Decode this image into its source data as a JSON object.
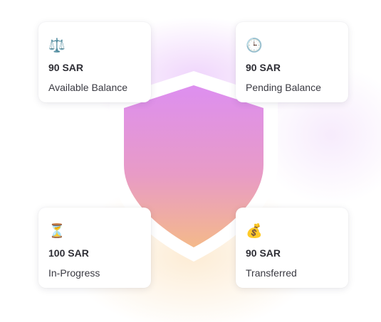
{
  "accent_colors": {
    "shield_top": "#dd8ff0",
    "shield_bottom": "#f4b98a",
    "shield_border": "#ffffff"
  },
  "cards": [
    {
      "icon": "scales-icon",
      "glyph": "⚖️",
      "amount": "90 SAR",
      "label": "Available Balance"
    },
    {
      "icon": "clock-icon",
      "glyph": "🕒",
      "amount": "90 SAR",
      "label": "Pending Balance"
    },
    {
      "icon": "hourglass-icon",
      "glyph": "⏳",
      "amount": "100 SAR",
      "label": "In-Progress"
    },
    {
      "icon": "money-bag-icon",
      "glyph": "💰",
      "amount": "90 SAR",
      "label": "Transferred"
    }
  ]
}
